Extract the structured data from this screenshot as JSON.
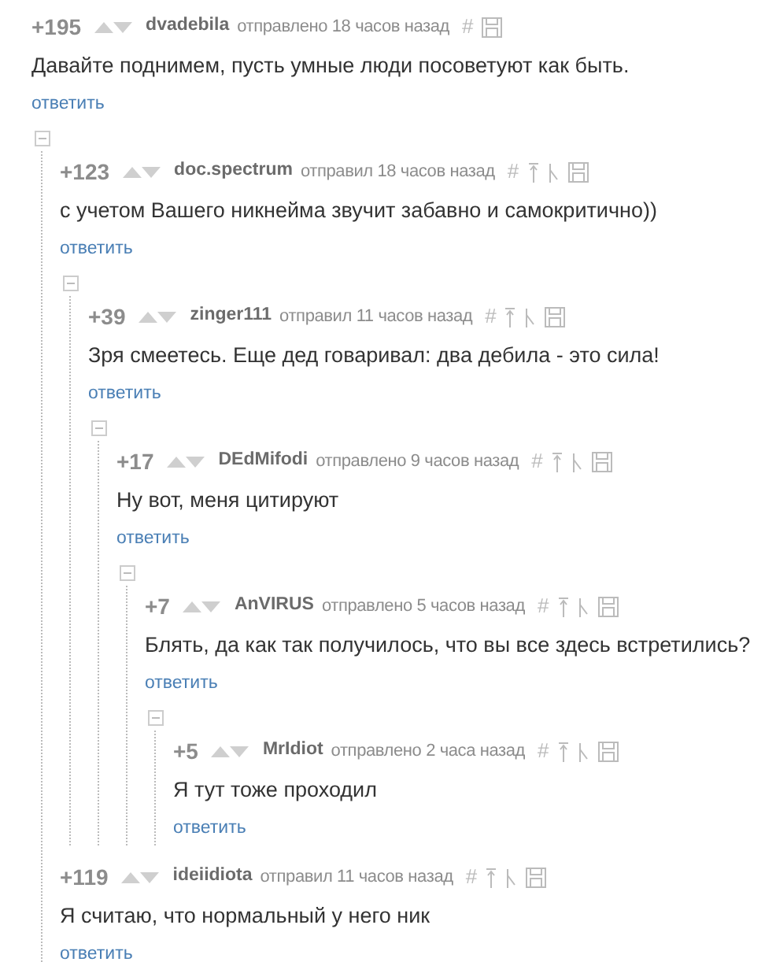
{
  "comments": [
    {
      "score": "+195",
      "author": "dvadebila",
      "time": "отправлено 18 часов назад",
      "hash": "#",
      "parent_links": false,
      "text": "Давайте поднимем, пусть умные люди посоветуют как быть.",
      "reply": "ответить",
      "expanded": true,
      "children": [
        {
          "score": "+123",
          "author": "doc.spectrum",
          "time": "отправил 18 часов назад",
          "hash": "#",
          "parent_links": true,
          "text": "с учетом Вашего никнейма звучит забавно и самокритично))",
          "reply": "ответить",
          "expanded": true,
          "children": [
            {
              "score": "+39",
              "author": "zinger111",
              "time": "отправил 11 часов назад",
              "hash": "#",
              "parent_links": true,
              "text": "Зря смеетесь. Еще дед говаривал: два дебила - это сила!",
              "reply": "ответить",
              "expanded": true,
              "children": [
                {
                  "score": "+17",
                  "author": "DEdMifodi",
                  "time": "отправлено 9 часов назад",
                  "hash": "#",
                  "parent_links": true,
                  "text": "Ну вот, меня цитируют",
                  "reply": "ответить",
                  "expanded": true,
                  "children": [
                    {
                      "score": "+7",
                      "author": "AnVIRUS",
                      "time": "отправлено 5 часов назад",
                      "hash": "#",
                      "parent_links": true,
                      "text": "Блять, да как так получилось, что вы все здесь встретились?",
                      "reply": "ответить",
                      "expanded": true,
                      "children": [
                        {
                          "score": "+5",
                          "author": "MrIdiot",
                          "time": "отправлено 2 часа назад",
                          "hash": "#",
                          "parent_links": true,
                          "text": "Я тут тоже проходил",
                          "reply": "ответить"
                        }
                      ]
                    }
                  ]
                }
              ]
            }
          ]
        },
        {
          "score": "+119",
          "author": "ideiidiota",
          "time": "отправил 11 часов назад",
          "hash": "#",
          "parent_links": true,
          "text": "Я считаю, что нормальный у него ник",
          "reply": "ответить"
        }
      ]
    }
  ]
}
